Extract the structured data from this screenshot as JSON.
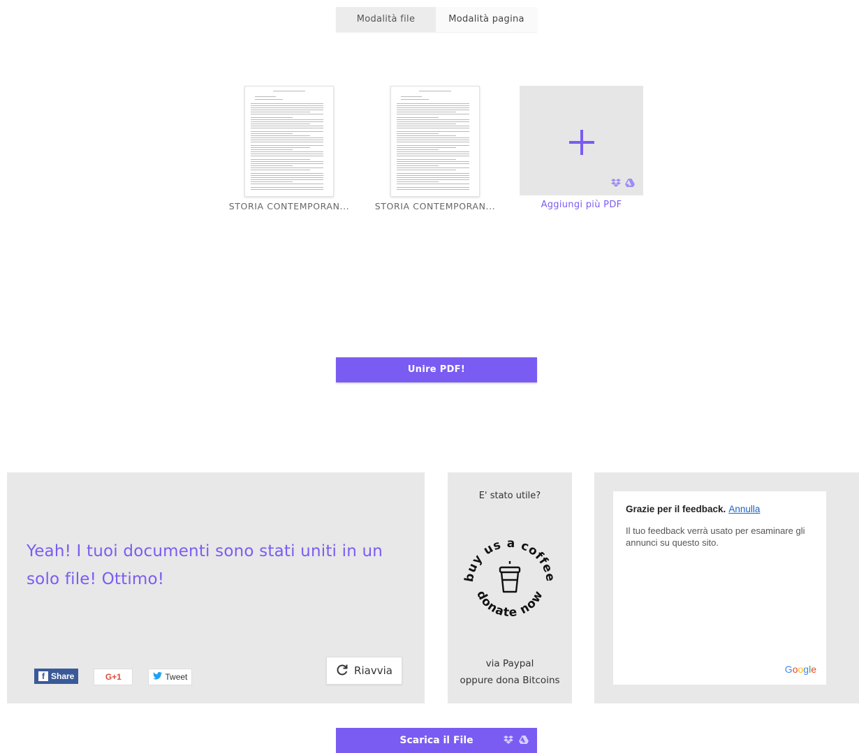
{
  "mode_tabs": [
    {
      "label": "Modalità file",
      "active": false
    },
    {
      "label": "Modalità pagina",
      "active": true
    }
  ],
  "files": [
    {
      "name": "STORIA CONTEMPORAN..."
    },
    {
      "name": "STORIA CONTEMPORAN..."
    }
  ],
  "add_more": {
    "label": "Aggiungi più PDF",
    "icons": [
      "dropbox-icon",
      "google-drive-icon"
    ]
  },
  "merge_button": {
    "label": "Unire PDF!"
  },
  "result": {
    "message": "Yeah! I tuoi documenti sono stati uniti in un solo file! Ottimo!",
    "social": {
      "facebook": "Share",
      "gplus": "G+1",
      "twitter": "Tweet"
    },
    "restart_label": "Riavvia"
  },
  "donate": {
    "question": "E' stato utile?",
    "badge_top": "buy us a coffee",
    "badge_bottom": "donate now",
    "via": "via Paypal",
    "bitcoin": "oppure dona Bitcoins"
  },
  "ad_feedback": {
    "title": "Grazie per il feedback.",
    "undo": "Annulla",
    "body": "Il tuo feedback verrà usato per esaminare gli annunci su questo sito.",
    "brand": "Google"
  },
  "download_button": {
    "label": "Scarica il File"
  },
  "colors": {
    "accent": "#7a5cf2",
    "panel": "#e8e8e8"
  }
}
